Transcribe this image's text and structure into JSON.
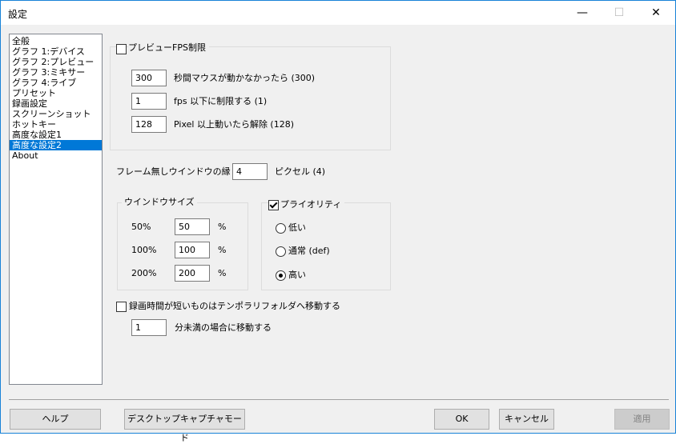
{
  "window": {
    "title": "設定",
    "minimize": "—",
    "maximize": "☐",
    "close": "✕"
  },
  "sidebar": {
    "items": [
      {
        "label": "全般",
        "selected": false
      },
      {
        "label": "グラフ 1:デバイス",
        "selected": false
      },
      {
        "label": "グラフ 2:プレビュー",
        "selected": false
      },
      {
        "label": "グラフ 3:ミキサー",
        "selected": false
      },
      {
        "label": "グラフ 4:ライブ",
        "selected": false
      },
      {
        "label": "プリセット",
        "selected": false
      },
      {
        "label": "録画設定",
        "selected": false
      },
      {
        "label": "スクリーンショット",
        "selected": false
      },
      {
        "label": "ホットキー",
        "selected": false
      },
      {
        "label": "高度な設定1",
        "selected": false
      },
      {
        "label": "高度な設定2",
        "selected": true
      },
      {
        "label": "About",
        "selected": false
      }
    ]
  },
  "preview_fps": {
    "label": "プレビューFPS制限",
    "checked": false,
    "rows": [
      {
        "value": "300",
        "label": "秒間マウスが動かなかったら (300)"
      },
      {
        "value": "1",
        "label": "fps 以下に制限する (1)"
      },
      {
        "value": "128",
        "label": "Pixel 以上動いたら解除 (128)"
      }
    ]
  },
  "frameless": {
    "label": "フレーム無しウインドウの縁",
    "value": "4",
    "unit": "ピクセル (4)"
  },
  "window_size": {
    "title": "ウインドウサイズ",
    "rows": [
      {
        "label": "50%",
        "value": "50",
        "unit": "%"
      },
      {
        "label": "100%",
        "value": "100",
        "unit": "%"
      },
      {
        "label": "200%",
        "value": "200",
        "unit": "%"
      }
    ]
  },
  "priority": {
    "label": "プライオリティ",
    "checked": true,
    "options": [
      {
        "label": "低い",
        "selected": false
      },
      {
        "label": "通常 (def)",
        "selected": false
      },
      {
        "label": "高い",
        "selected": true
      }
    ]
  },
  "short_rec": {
    "label": "録画時間が短いものはテンポラリフォルダへ移動する",
    "checked": false,
    "value": "1",
    "unit": "分未満の場合に移動する"
  },
  "buttons": {
    "help": "ヘルプ",
    "desktop": "デスクトップキャプチャモード",
    "ok": "OK",
    "cancel": "キャンセル",
    "apply": "適用"
  }
}
